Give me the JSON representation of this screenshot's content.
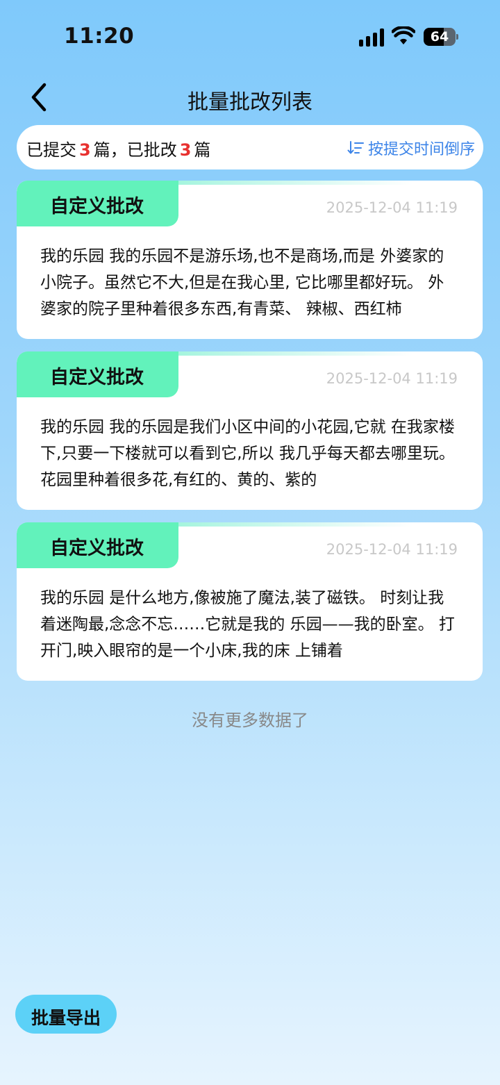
{
  "status_bar": {
    "time": "11:20",
    "battery": "64",
    "battery_level": 0.64
  },
  "nav": {
    "title": "批量批改列表"
  },
  "summary": {
    "submitted_prefix": "已提交",
    "submitted_count": "3",
    "submitted_unit": "篇，",
    "graded_prefix": "已批改",
    "graded_count": "3",
    "graded_unit": "篇",
    "sort_label": "按提交时间倒序",
    "accent_color": "#e8312f",
    "sort_color": "#3c84e8"
  },
  "cards": [
    {
      "tag": "自定义批改",
      "date": "2025-12-04 11:19",
      "excerpt": "我的乐园 我的乐园不是游乐场,也不是商场,而是 外婆家的小院子。虽然它不大,但是在我心里, 它比哪里都好玩。 外婆家的院子里种着很多东西,有青菜、 辣椒、西红柿"
    },
    {
      "tag": "自定义批改",
      "date": "2025-12-04 11:19",
      "excerpt": "我的乐园 我的乐园是我们小区中间的小花园,它就 在我家楼下,只要一下楼就可以看到它,所以 我几乎每天都去哪里玩。 花园里种着很多花,有红的、黄的、紫的"
    },
    {
      "tag": "自定义批改",
      "date": "2025-12-04 11:19",
      "excerpt": "我的乐园 是什么地方,像被施了魔法,装了磁铁。 时刻让我着迷陶最,念念不忘……它就是我的 乐园——我的卧室。 打开门,映入眼帘的是一个小床,我的床 上铺着"
    }
  ],
  "footer": {
    "no_more": "没有更多数据了"
  },
  "export": {
    "label": "批量导出"
  },
  "icons": {
    "back": "chevron-left-icon",
    "sort": "sort-descending-icon",
    "signal": "cellular-signal-icon",
    "wifi": "wifi-icon",
    "battery": "battery-icon"
  }
}
